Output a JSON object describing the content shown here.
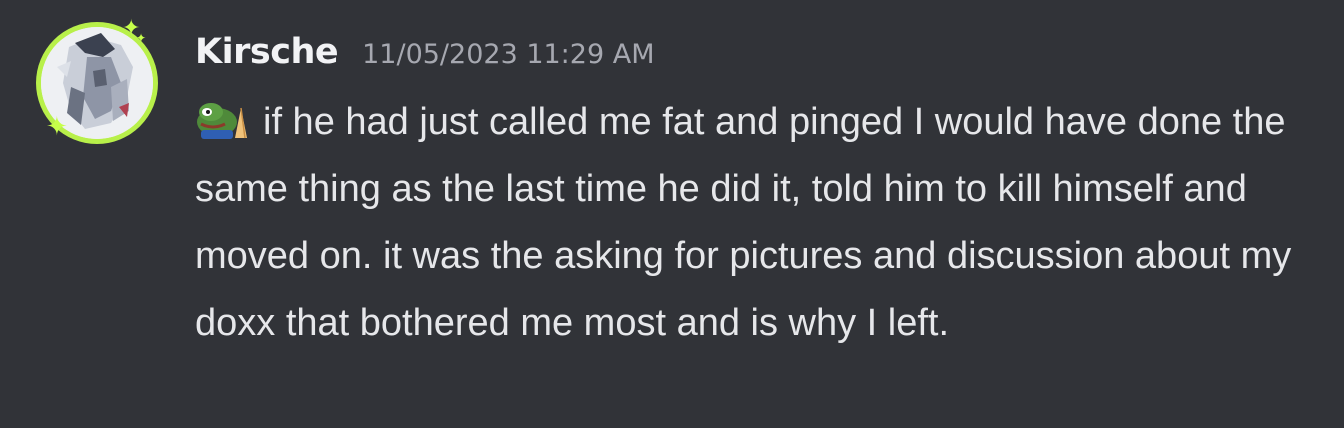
{
  "message": {
    "author": "Kirsche",
    "timestamp": "11/05/2023 11:29 AM",
    "avatar_icon": "user-avatar",
    "emoji_icon": "praying-pepe-emoji",
    "text": "if he had just called me fat and pinged I would have done the same thing as the last time he did it, told him to kill himself and moved on. it was the asking for pictures and discussion about my doxx that bothered me most and is why I left."
  },
  "colors": {
    "background": "#313338",
    "username": "#f2f3f5",
    "timestamp": "#a6a8b0",
    "text": "#e6e7ea",
    "avatar_ring": "#b8f04a"
  }
}
